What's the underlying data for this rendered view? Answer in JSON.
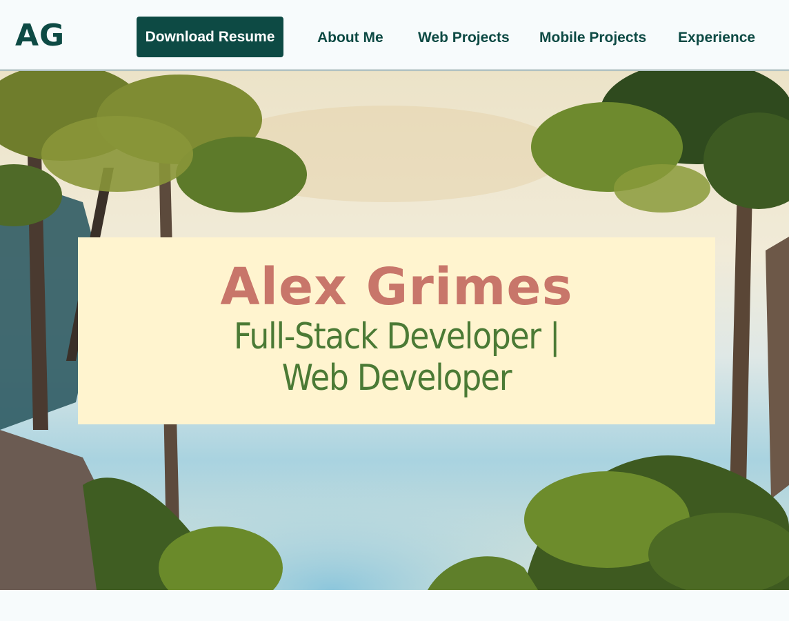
{
  "header": {
    "logo": "AG",
    "download_label": "Download Resume",
    "nav": [
      {
        "label": "About Me"
      },
      {
        "label": "Web Projects"
      },
      {
        "label": "Mobile Projects"
      },
      {
        "label": "Experience"
      }
    ]
  },
  "hero": {
    "name": "Alex Grimes",
    "subtitle": "Full-Stack Developer | Web Developer",
    "background": "watercolor-trees-lake-illustration"
  },
  "colors": {
    "brand": "#0d4a44",
    "card": "#fff4cf",
    "name": "#c8766a",
    "subtitle": "#4b7a35"
  }
}
